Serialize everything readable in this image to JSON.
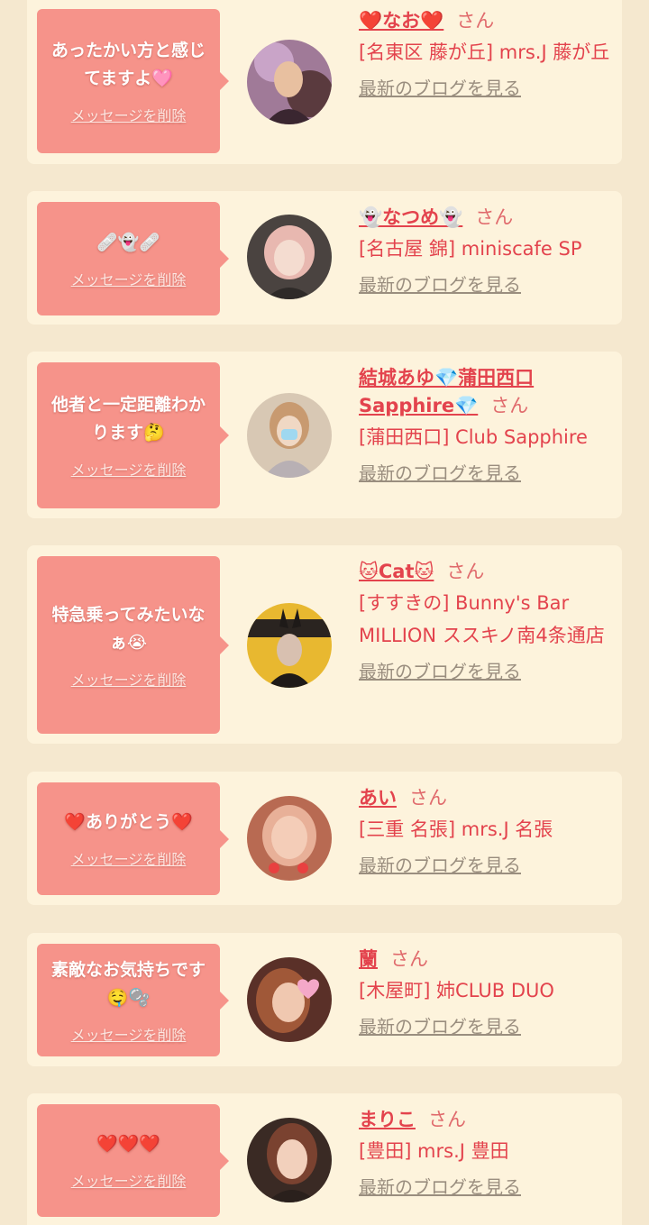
{
  "delete_label": "メッセージを削除",
  "blog_label": "最新のブログを見る",
  "honorific": "さん",
  "cards": [
    {
      "message": "あったかい方と感じてますよ🩷",
      "name": "❤️なお❤️",
      "shop": "[名東区 藤が丘] mrs.J 藤が丘"
    },
    {
      "message": "🩹👻🩹",
      "name": "👻なつめ👻",
      "shop": "[名古屋 錦] miniscafe SP"
    },
    {
      "message": "他者と一定距離わかります🤔",
      "name": "結城あゆ💎蒲田西口Sapphire💎",
      "shop": "[蒲田西口] Club Sapphire"
    },
    {
      "message": "特急乗ってみたいなぁ😭",
      "name": "🐱Cat🐱",
      "shop": "[すすきの] Bunny's Bar MILLION ススキノ南4条通店"
    },
    {
      "message": "❤️ありがとう❤️",
      "name": "あい",
      "shop": "[三重 名張] mrs.J 名張"
    },
    {
      "message": "素敵なお気持ちです🤤🫧",
      "name": "蘭",
      "shop": "[木屋町] 姉CLUB DUO"
    },
    {
      "message": "❤️❤️❤️",
      "name": "まりこ",
      "shop": "[豊田] mrs.J 豊田"
    }
  ],
  "colors": {
    "page_background": "#f5e8cf",
    "card_background": "#fdf3dc",
    "bubble": "#f6938a",
    "name": "#e3434d",
    "link_gray": "#9a8e7f"
  }
}
